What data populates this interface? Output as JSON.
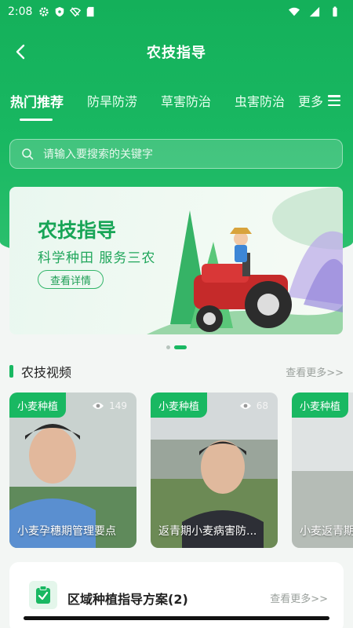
{
  "status": {
    "time": "2:08"
  },
  "header": {
    "title": "农技指导"
  },
  "tabs": [
    {
      "label": "热门推荐",
      "active": true
    },
    {
      "label": "防旱防涝"
    },
    {
      "label": "草害防治"
    },
    {
      "label": "虫害防治"
    }
  ],
  "more_label": "更多",
  "search": {
    "placeholder": "请输入要搜索的关键字"
  },
  "banner": {
    "title": "农技指导",
    "subtitle": "科学种田 服务三农",
    "button": "查看详情"
  },
  "videos_section": {
    "title": "农技视频",
    "more": "查看更多>>"
  },
  "videos": [
    {
      "tag": "小麦种植",
      "views": "149",
      "title": "小麦孕穗期管理要点"
    },
    {
      "tag": "小麦种植",
      "views": "68",
      "title": "返青期小麦病害防..."
    },
    {
      "tag": "小麦种植",
      "views": "",
      "title": "小麦返青期"
    }
  ],
  "plan_section": {
    "title": "区域种植指导方案(2)",
    "more": "查看更多>>"
  },
  "colors": {
    "accent": "#19b862",
    "text": "#222222",
    "muted": "#9aa09c"
  }
}
